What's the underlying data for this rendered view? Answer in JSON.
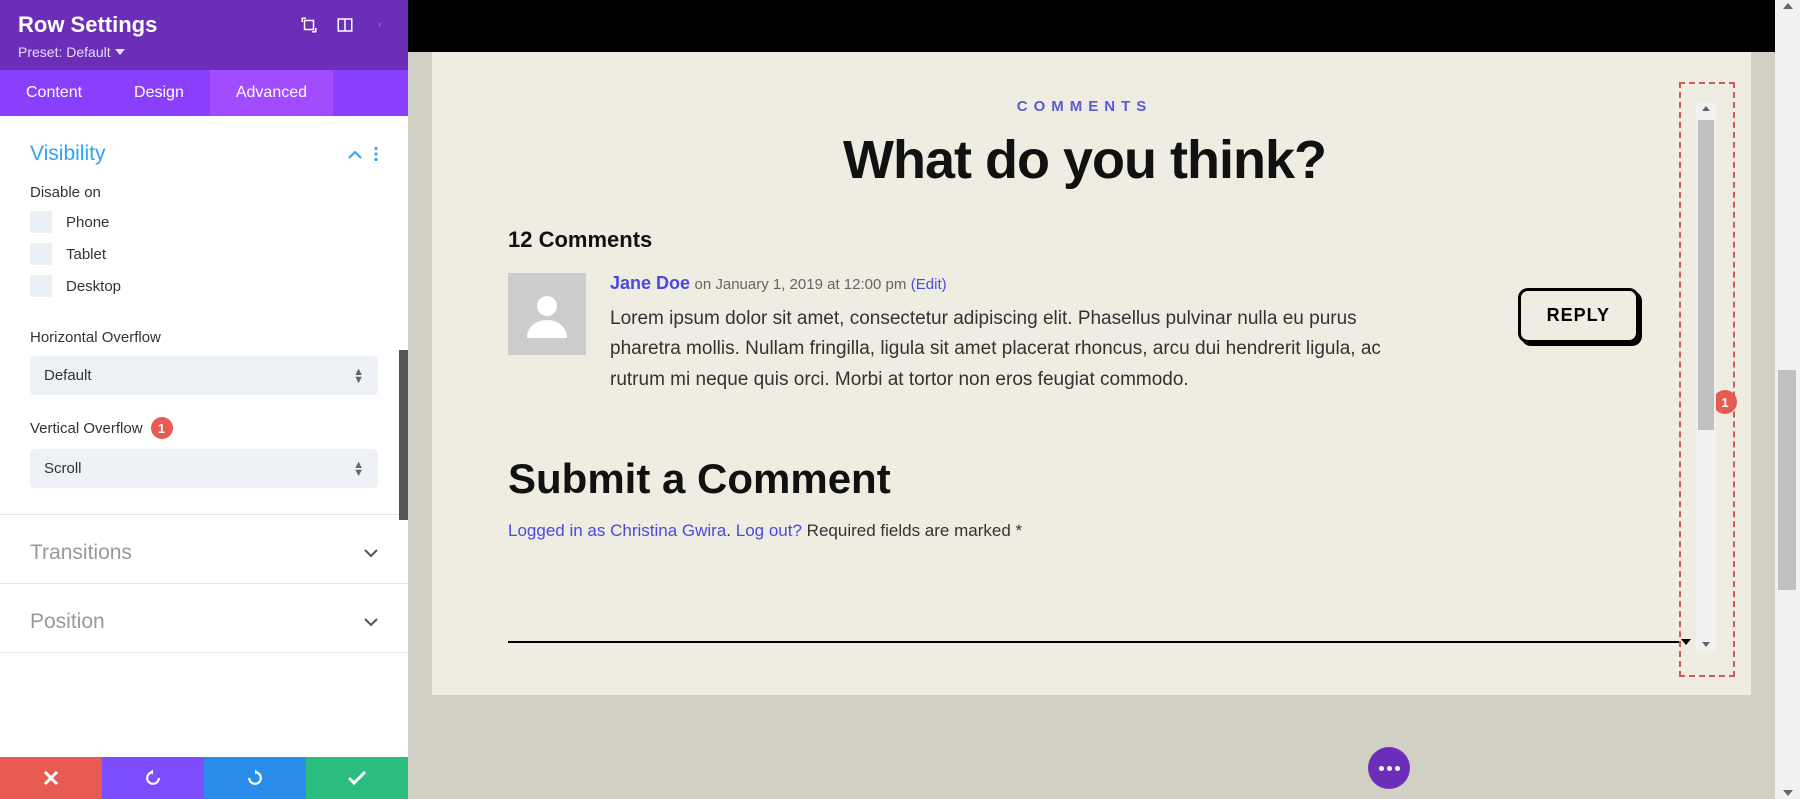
{
  "panel": {
    "title": "Row Settings",
    "preset_label": "Preset: Default"
  },
  "tabs": {
    "content": "Content",
    "design": "Design",
    "advanced": "Advanced"
  },
  "visibility": {
    "title": "Visibility",
    "disable_on_label": "Disable on",
    "options": {
      "phone": "Phone",
      "tablet": "Tablet",
      "desktop": "Desktop"
    },
    "h_overflow_label": "Horizontal Overflow",
    "h_overflow_value": "Default",
    "v_overflow_label": "Vertical Overflow",
    "v_overflow_badge": "1",
    "v_overflow_value": "Scroll"
  },
  "sections": {
    "transitions": "Transitions",
    "position": "Position"
  },
  "preview": {
    "eyebrow": "COMMENTS",
    "headline": "What do you think?",
    "count": "12 Comments",
    "comment": {
      "author": "Jane Doe",
      "date": "on January 1, 2019 at 12:00 pm",
      "edit": "(Edit)",
      "text": "Lorem ipsum dolor sit amet, consectetur adipiscing elit. Phasellus pulvinar nulla eu purus pharetra mollis. Nullam fringilla, ligula sit amet placerat rhoncus, arcu dui hendrerit ligula, ac rutrum mi neque quis orci. Morbi at tortor non eros feugiat commodo.",
      "reply": "REPLY"
    },
    "submit_heading": "Submit a Comment",
    "logged_prefix": "Logged in as ",
    "logged_user": "Christina Gwira",
    "logout": "Log out?",
    "required": "Required fields are marked *",
    "outer_badge": "1"
  }
}
